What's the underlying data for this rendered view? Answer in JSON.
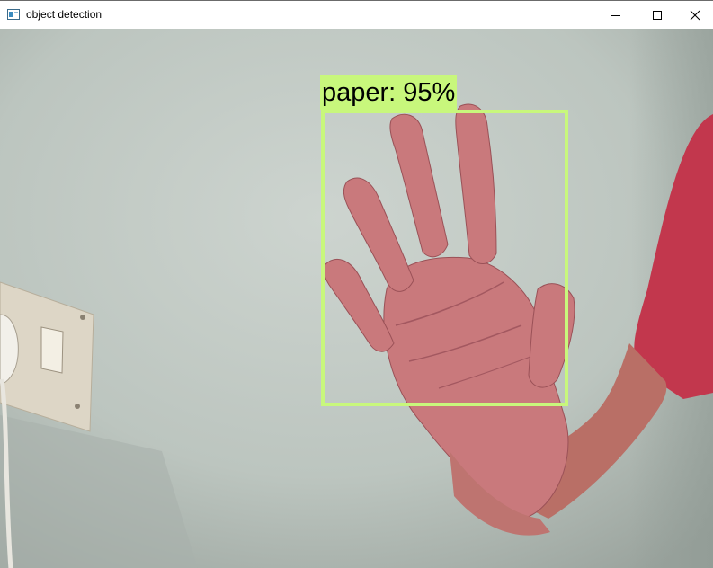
{
  "window": {
    "title": "object detection",
    "app_icon": "opencv-window-icon",
    "controls": {
      "minimize": "minimize-icon",
      "maximize": "maximize-icon",
      "close": "close-icon"
    }
  },
  "detection": {
    "label": "paper: 95%",
    "box_color": "#c8f77c"
  },
  "colors": {
    "wall": "#c3cbc6",
    "skin": "#c97b7e",
    "shirt": "#c2374d",
    "switch_plate": "#dcd6c8"
  }
}
